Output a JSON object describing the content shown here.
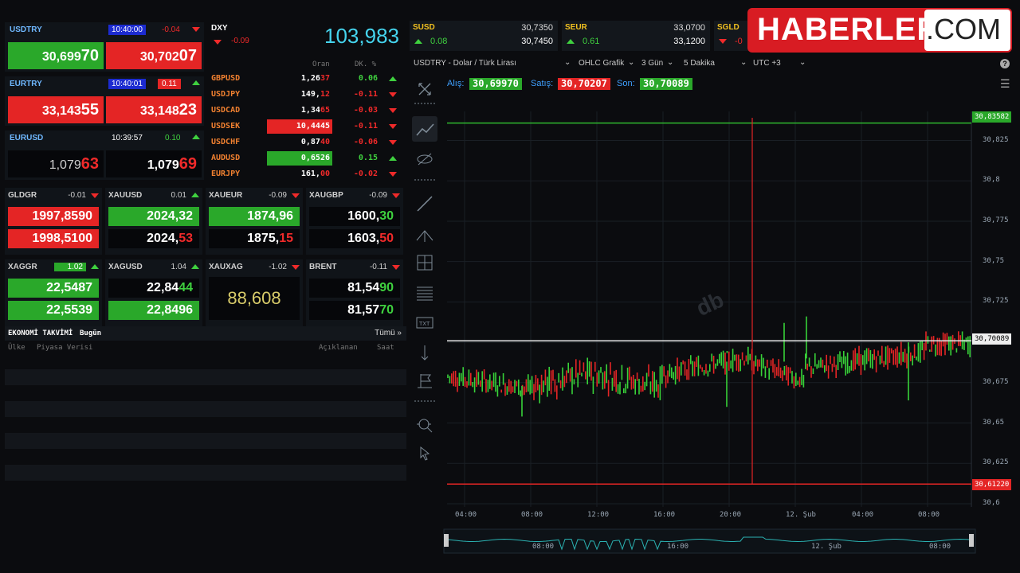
{
  "tiles": {
    "usdtry": {
      "symbol": "USDTRY",
      "time": "10:40:00",
      "change": "-0.04",
      "bid_main": "30,699",
      "bid_big": "70",
      "ask_main": "30,702",
      "ask_big": "07"
    },
    "eurtry": {
      "symbol": "EURTRY",
      "time": "10:40:01",
      "change": "0.11",
      "bid_main": "33,143",
      "bid_big": "55",
      "ask_main": "33,148",
      "ask_big": "23"
    },
    "eurusd": {
      "symbol": "EURUSD",
      "time": "10:39:57",
      "change": "0.10",
      "bid_main": "1,079",
      "bid_big": "63",
      "ask_main": "1,079",
      "ask_big": "69"
    }
  },
  "dxy": {
    "symbol": "DXY",
    "change": "-0.09",
    "value": "103,983"
  },
  "fx_table": {
    "col_rate": "Oran",
    "col_change": "DK. %",
    "rows": [
      {
        "symbol": "GBPUSD",
        "main": "1,26",
        "tail": "37",
        "change": "0.06",
        "dir": "up",
        "hl": ""
      },
      {
        "symbol": "USDJPY",
        "main": "149,",
        "tail": "12",
        "change": "-0.11",
        "dir": "dn",
        "hl": ""
      },
      {
        "symbol": "USDCAD",
        "main": "1,34",
        "tail": "65",
        "change": "-0.03",
        "dir": "dn",
        "hl": ""
      },
      {
        "symbol": "USDSEK",
        "main": "10,4445",
        "tail": "",
        "change": "-0.11",
        "dir": "dn",
        "hl": "red"
      },
      {
        "symbol": "USDCHF",
        "main": "0,87",
        "tail": "40",
        "change": "-0.06",
        "dir": "dn",
        "hl": ""
      },
      {
        "symbol": "AUDUSD",
        "main": "0,6526",
        "tail": "",
        "change": "0.15",
        "dir": "up",
        "hl": "green"
      },
      {
        "symbol": "EURJPY",
        "main": "161,",
        "tail": "00",
        "change": "-0.02",
        "dir": "dn",
        "hl": ""
      }
    ]
  },
  "metals": [
    {
      "symbol": "GLDGR",
      "change": "-0.01",
      "dir": "dn",
      "p1": "1997,8590",
      "p1_tail": "",
      "p1_bg": "red",
      "p2": "1998,5100",
      "p2_tail": "",
      "p2_bg": "red"
    },
    {
      "symbol": "XAUUSD",
      "change": "0.01",
      "dir": "up",
      "p1": "2024,32",
      "p1_tail": "",
      "p1_bg": "green",
      "p2": "2024,",
      "p2_tail": "53",
      "p2_bg": "black"
    },
    {
      "symbol": "XAUEUR",
      "change": "-0.09",
      "dir": "dn",
      "p1": "1874,96",
      "p1_tail": "",
      "p1_bg": "green",
      "p2": "1875,",
      "p2_tail": "15",
      "p2_bg": "black"
    },
    {
      "symbol": "XAUGBP",
      "change": "-0.09",
      "dir": "dn",
      "p1": "1600,",
      "p1_tail": "30",
      "p1_bg": "black",
      "p2": "1603,",
      "p2_tail": "50",
      "p2_bg": "black"
    },
    {
      "symbol": "XAGGR",
      "change": "1.02",
      "dir": "up",
      "p1": "22,5487",
      "p1_tail": "",
      "p1_bg": "green",
      "p2": "22,5539",
      "p2_tail": "",
      "p2_bg": "green"
    },
    {
      "symbol": "XAGUSD",
      "change": "1.04",
      "dir": "up",
      "p1": "22,84",
      "p1_tail": "44",
      "p1_bg": "black",
      "p2": "22,8496",
      "p2_tail": "",
      "p2_bg": "green"
    },
    {
      "symbol": "XAUXAG",
      "change": "-1.02",
      "dir": "dn",
      "single": "88,608"
    },
    {
      "symbol": "BRENT",
      "change": "-0.11",
      "dir": "dn",
      "p1": "81,54",
      "p1_tail": "90",
      "p1_bg": "black",
      "p2": "81,57",
      "p2_tail": "70",
      "p2_bg": "black"
    }
  ],
  "calendar": {
    "title": "EKONOMİ TAKVİMİ",
    "today": "Bugün",
    "all": "Tümü »",
    "col_country": "Ülke",
    "col_data": "Piyasa Verisi",
    "col_announced": "Açıklanan",
    "col_time": "Saat"
  },
  "top_quotes": [
    {
      "symbol": "SUSD",
      "v1": "30,7350",
      "change": "0.08",
      "v2": "30,7450"
    },
    {
      "symbol": "SEUR",
      "v1": "33,0700",
      "change": "0.61",
      "v2": "33,1200"
    },
    {
      "symbol": "SGLD",
      "change": "-0"
    }
  ],
  "logo": {
    "main": "HABERLER",
    "suffix": ".COM"
  },
  "chart_toolbar": {
    "title": "USDTRY - Dolar / Türk Lirası",
    "type": "OHLC Grafik",
    "range": "3 Gün",
    "interval": "5 Dakika",
    "tz": "UTC +3"
  },
  "chart_quotes": {
    "bid_label": "Alış:",
    "bid": "30,69970",
    "ask_label": "Satış:",
    "ask": "30,70207",
    "last_label": "Son:",
    "last": "30,70089"
  },
  "chart_watermark": "db",
  "chart_data": {
    "type": "candlestick",
    "title": "",
    "x_ticks": [
      "04:00",
      "08:00",
      "12:00",
      "16:00",
      "20:00",
      "12. Şub",
      "04:00",
      "08:00"
    ],
    "y_ticks": [
      "30,825",
      "30,8",
      "30,775",
      "30,75",
      "30,725",
      "30,7",
      "30,675",
      "30,65",
      "30,625",
      "30,6"
    ],
    "ylim": [
      30.598,
      30.843
    ],
    "high_line": "30,83582",
    "low_line": "30,61220",
    "last_line": "30,70089",
    "high_value": 30.83582,
    "low_value": 30.6122,
    "last_value": 30.70089,
    "navigator_ticks": [
      "08:00",
      "16:00",
      "12. Şub",
      "08:00"
    ]
  },
  "colors": {
    "up": "#3fd13f",
    "down": "#f02a2a",
    "accent_blue": "#6fb8ff",
    "logo_red": "#d81c23"
  }
}
